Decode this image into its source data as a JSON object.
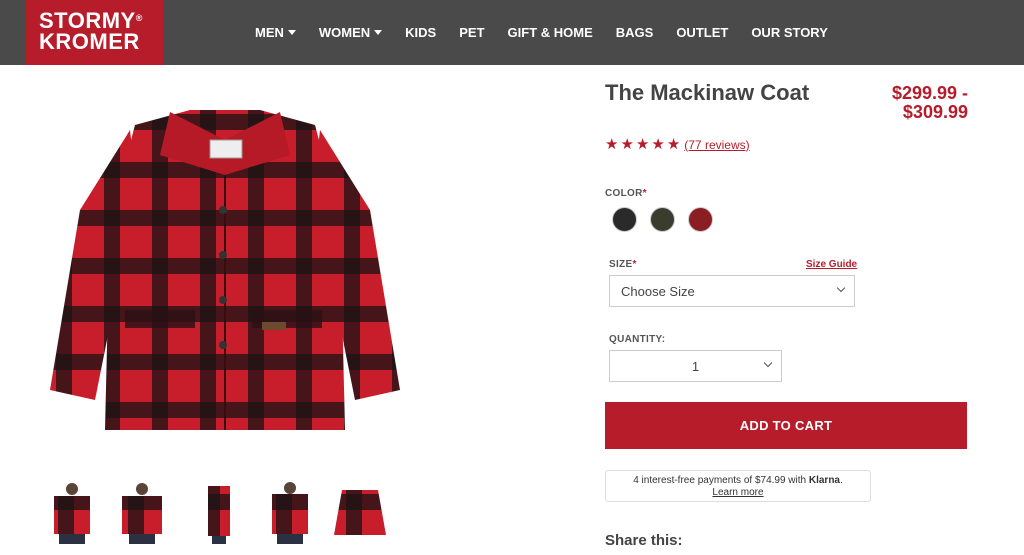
{
  "brand": {
    "line1": "STORMY",
    "line2": "KROMER",
    "reg": "®",
    "color": "#b71c2b"
  },
  "nav": [
    {
      "label": "MEN",
      "dropdown": true
    },
    {
      "label": "WOMEN",
      "dropdown": true
    },
    {
      "label": "KIDS",
      "dropdown": false
    },
    {
      "label": "PET",
      "dropdown": false
    },
    {
      "label": "GIFT & HOME",
      "dropdown": false
    },
    {
      "label": "BAGS",
      "dropdown": false
    },
    {
      "label": "OUTLET",
      "dropdown": false
    },
    {
      "label": "OUR STORY",
      "dropdown": false
    }
  ],
  "product": {
    "title": "The Mackinaw Coat",
    "price_line1": "$299.99 -",
    "price_line2": "$309.99",
    "rating_stars": 5,
    "reviews_label": "(77 reviews)"
  },
  "options": {
    "color_label": "COLOR",
    "colors": [
      "#2a2a2a",
      "#3a3d2e",
      "#8b1e22"
    ],
    "size_label": "SIZE",
    "size_guide": "Size Guide",
    "size_value": "Choose Size",
    "quantity_label": "QUANTITY:",
    "quantity_value": "1",
    "required_mark": "*"
  },
  "cart": {
    "add_label": "ADD TO CART"
  },
  "klarna": {
    "text": "4 interest-free payments of $74.99 with ",
    "brand": "Klarna",
    "period": ".",
    "learn_more": "Learn more"
  },
  "share": {
    "label": "Share this:"
  },
  "thumbnails": [
    "front-model",
    "front-model-2",
    "side-model",
    "back-model",
    "flat-coat"
  ]
}
